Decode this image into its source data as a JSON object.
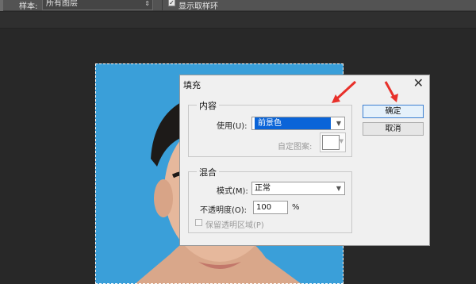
{
  "options_bar": {
    "sample_label": "样本:",
    "sample_value": "所有图层",
    "show_ring_label": "显示取样环",
    "show_ring_checked": true
  },
  "dialog": {
    "title": "填充",
    "close_glyph": "✕",
    "contents": {
      "legend": "内容",
      "use_label": "使用(U):",
      "use_value": "前景色",
      "custom_pattern_label": "自定图案:"
    },
    "blending": {
      "legend": "混合",
      "mode_label": "模式(M):",
      "mode_value": "正常",
      "opacity_label": "不透明度(O):",
      "opacity_value": "100",
      "opacity_unit": "%",
      "preserve_transparency_label": "保留透明区域(P)"
    },
    "ok_label": "确定",
    "cancel_label": "取消"
  },
  "colors": {
    "canvas_bg": "#282828",
    "photo_bg": "#3a9fd9",
    "highlight": "#0a64d8",
    "annotation_arrow": "#e8302a"
  }
}
